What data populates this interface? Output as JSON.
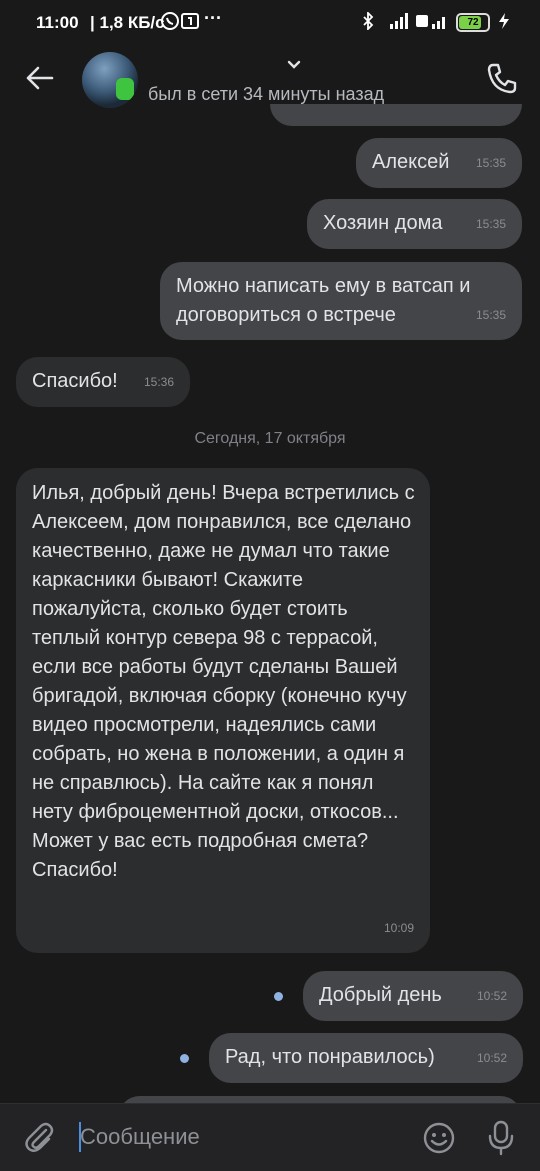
{
  "status_bar": {
    "time": "11:00",
    "speed": "1,8 КБ/с",
    "battery": "72"
  },
  "header": {
    "last_seen": "был в сети 34 минуты назад"
  },
  "messages": [
    {
      "text": "Алексей",
      "time": "15:35",
      "dir": "out"
    },
    {
      "text": "Хозяин дома",
      "time": "15:35",
      "dir": "out"
    },
    {
      "text": "Можно написать ему в ватсап и договориться о встрече",
      "time": "15:35",
      "dir": "out"
    },
    {
      "text": "Спасибо!",
      "time": "15:36",
      "dir": "in"
    },
    {
      "text": "Илья, добрый день! Вчера встретились с Алексеем, дом понравился, все сделано качественно, даже не думал что такие каркасники бывают! Скажите пожалуйста, сколько будет стоить теплый контур севера 98 с террасой, если все работы будут сделаны Вашей бригадой, включая сборку (конечно кучу видео просмотрели, надеялись сами собрать, но жена в положении, а один я не справлюсь). На сайте как я понял нету фиброцементной доски, откосов... Может у вас есть подробная смета? Спасибо!",
      "time": "10:09",
      "dir": "in"
    },
    {
      "text": "Добрый день",
      "time": "10:52",
      "dir": "out"
    },
    {
      "text": "Рад, что понравилось)",
      "time": "10:52",
      "dir": "out"
    }
  ],
  "date_separator": "Сегодня, 17 октября",
  "composer": {
    "placeholder": "Сообщение"
  }
}
